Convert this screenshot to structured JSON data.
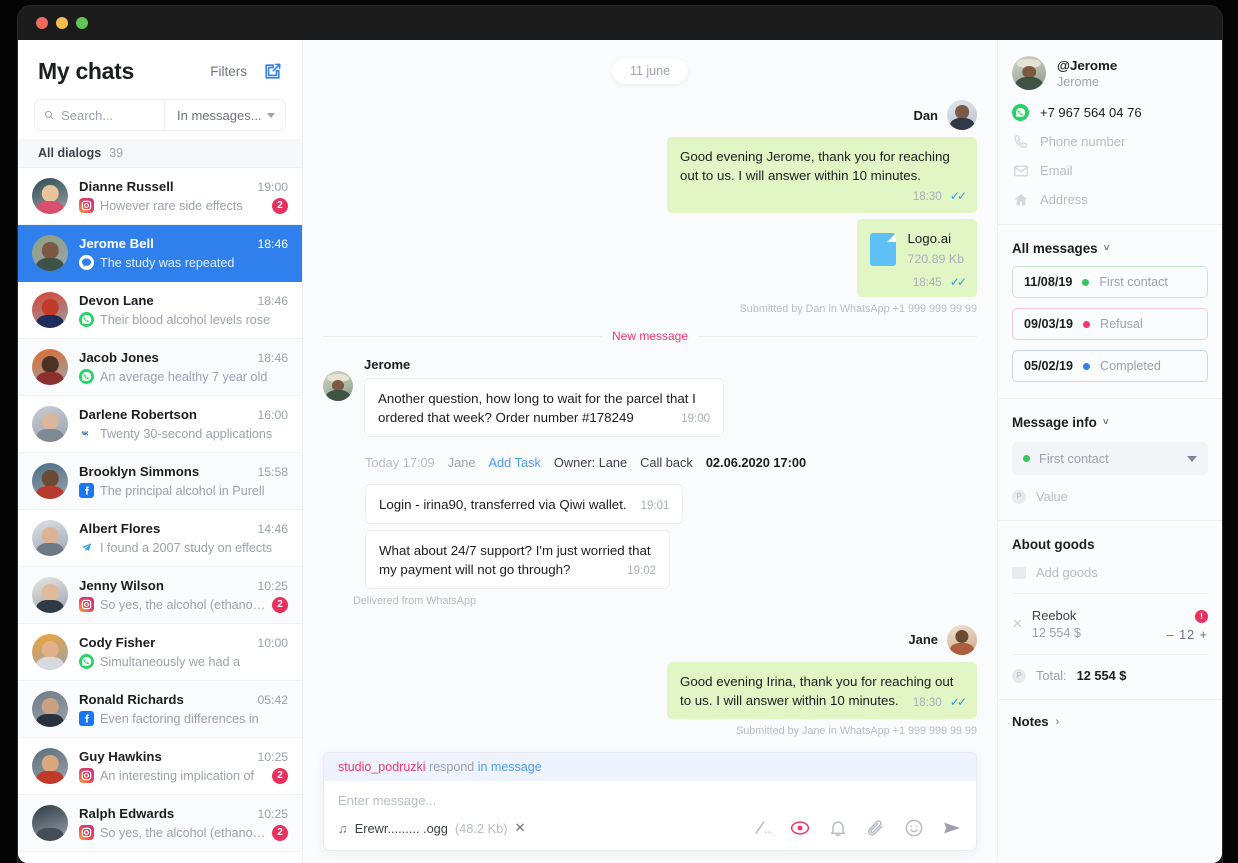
{
  "window": {
    "dots": [
      "close",
      "minimize",
      "zoom"
    ]
  },
  "sidebar": {
    "title": "My chats",
    "filters_label": "Filters",
    "compose_icon": "compose-icon",
    "search": {
      "placeholder": "Search...",
      "value": ""
    },
    "scope": {
      "label": "In messages...",
      "icon": "chevron-down-icon"
    },
    "dialogs": {
      "label": "All dialogs",
      "count": "39"
    },
    "chats": [
      {
        "name": "Dianne Russell",
        "time": "19:00",
        "preview": "However rare side effects",
        "source": "instagram",
        "badge": "2",
        "active": false
      },
      {
        "name": "Jerome Bell",
        "time": "18:46",
        "preview": "The study was repeated",
        "source": "message",
        "badge": "",
        "active": true
      },
      {
        "name": "Devon Lane",
        "time": "18:46",
        "preview": "Their blood alcohol levels rose",
        "source": "whatsapp",
        "badge": "",
        "active": false
      },
      {
        "name": "Jacob Jones",
        "time": "18:46",
        "preview": "An average healthy 7 year old",
        "source": "whatsapp",
        "badge": "",
        "active": false
      },
      {
        "name": "Darlene Robertson",
        "time": "16:00",
        "preview": "Twenty 30-second applications",
        "source": "vk",
        "badge": "",
        "active": false
      },
      {
        "name": "Brooklyn Simmons",
        "time": "15:58",
        "preview": "The principal alcohol in Purell",
        "source": "facebook",
        "badge": "",
        "active": false
      },
      {
        "name": "Albert Flores",
        "time": "14:46",
        "preview": "I found a 2007 study on effects",
        "source": "telegram",
        "badge": "",
        "active": false
      },
      {
        "name": "Jenny Wilson",
        "time": "10:25",
        "preview": "So yes, the alcohol (ethanol) in",
        "source": "instagram",
        "badge": "2",
        "active": false
      },
      {
        "name": "Cody Fisher",
        "time": "10:00",
        "preview": "Simultaneously we had a",
        "source": "whatsapp",
        "badge": "",
        "active": false
      },
      {
        "name": "Ronald Richards",
        "time": "05:42",
        "preview": "Even factoring differences in",
        "source": "facebook",
        "badge": "",
        "active": false
      },
      {
        "name": "Guy Hawkins",
        "time": "10:25",
        "preview": "An interesting implication of",
        "source": "instagram",
        "badge": "2",
        "active": false
      },
      {
        "name": "Ralph Edwards",
        "time": "10:25",
        "preview": "So yes, the alcohol (ethanol) in",
        "source": "instagram",
        "badge": "2",
        "active": false
      }
    ]
  },
  "chat": {
    "date_chip": "11 june",
    "out_group_1": {
      "author": "Dan",
      "message": "Good evening Jerome, thank you for reaching out to us. I will answer within 10 minutes.",
      "time": "18:30",
      "file_name": "Logo.ai",
      "file_size": "720.89 Kb",
      "file_time": "18:45",
      "footer": "Submitted by Dan in WhatsApp +1 999 999 99 99"
    },
    "new_message_divider": "New message",
    "in_group": {
      "author": "Jerome",
      "message_1": "Another question, how long to wait for the parcel that I ordered that week? Order number #178249",
      "time_1": "19:00",
      "message_2": "Login - irina90, transferred via Qiwi wallet.",
      "time_2": "19:01",
      "message_3": "What about 24/7 support? I'm just worried that my payment will not go through?",
      "time_3": "19:02",
      "footer": "Delivered from WhatsApp"
    },
    "task_row": {
      "time": "Today 17:09",
      "user": "Jane",
      "add_task": "Add Task",
      "owner": "Owner: Lane",
      "call_back": "Call back",
      "call_back_date": "02.06.2020 17:00"
    },
    "out_group_2": {
      "author": "Jane",
      "message": "Good evening Irina, thank you for reaching out to us. I will answer within 10 minutes.",
      "time": "18:30",
      "footer": "Submitted by Jane in WhatsApp +1 999 999 99 99"
    },
    "compose": {
      "reply_user": "studio_podruzki",
      "reply_mid": "respond",
      "reply_link": "in message",
      "placeholder": "Enter message...",
      "attachment_name": "Erewr......... .ogg",
      "attachment_size": "(48.2 Kb)",
      "attachment_remove": "✕",
      "actions": [
        "signature-icon",
        "record-icon",
        "bell-icon",
        "attach-icon",
        "emoji-icon",
        "send-icon"
      ]
    }
  },
  "right_panel": {
    "contact": {
      "handle": "@Jerome",
      "name": "Jerome"
    },
    "fields": [
      {
        "icon": "whatsapp-icon",
        "value": "+7 967 564 04 76",
        "filled": true
      },
      {
        "icon": "phone-icon",
        "value": "Phone number",
        "filled": false
      },
      {
        "icon": "email-icon",
        "value": "Email",
        "filled": false
      },
      {
        "icon": "address-icon",
        "value": "Address",
        "filled": false
      }
    ],
    "all_messages": {
      "title": "All messages",
      "chevron": "˅"
    },
    "stages": [
      {
        "date": "11/08/19",
        "label": "First contact",
        "color": "#34c759",
        "tone": "green"
      },
      {
        "date": "09/03/19",
        "label": "Refusal",
        "color": "#f0366d",
        "tone": "pink"
      },
      {
        "date": "05/02/19",
        "label": "Completed",
        "color": "#3a7bf0",
        "tone": "blue"
      }
    ],
    "message_info": {
      "title": "Message info",
      "chevron": "˅",
      "selected_stage": "First contact",
      "value_label": "Value"
    },
    "goods": {
      "title": "About goods",
      "add_label": "Add goods",
      "items": [
        {
          "name": "Reebok",
          "price": "12 554 $",
          "alert": "!",
          "qty_minus": "–",
          "qty": "12",
          "qty_plus": "+",
          "remove": "✕"
        }
      ],
      "total_label": "Total:",
      "total_value": "12 554 $"
    },
    "notes": {
      "title": "Notes",
      "arrow": "›"
    }
  }
}
